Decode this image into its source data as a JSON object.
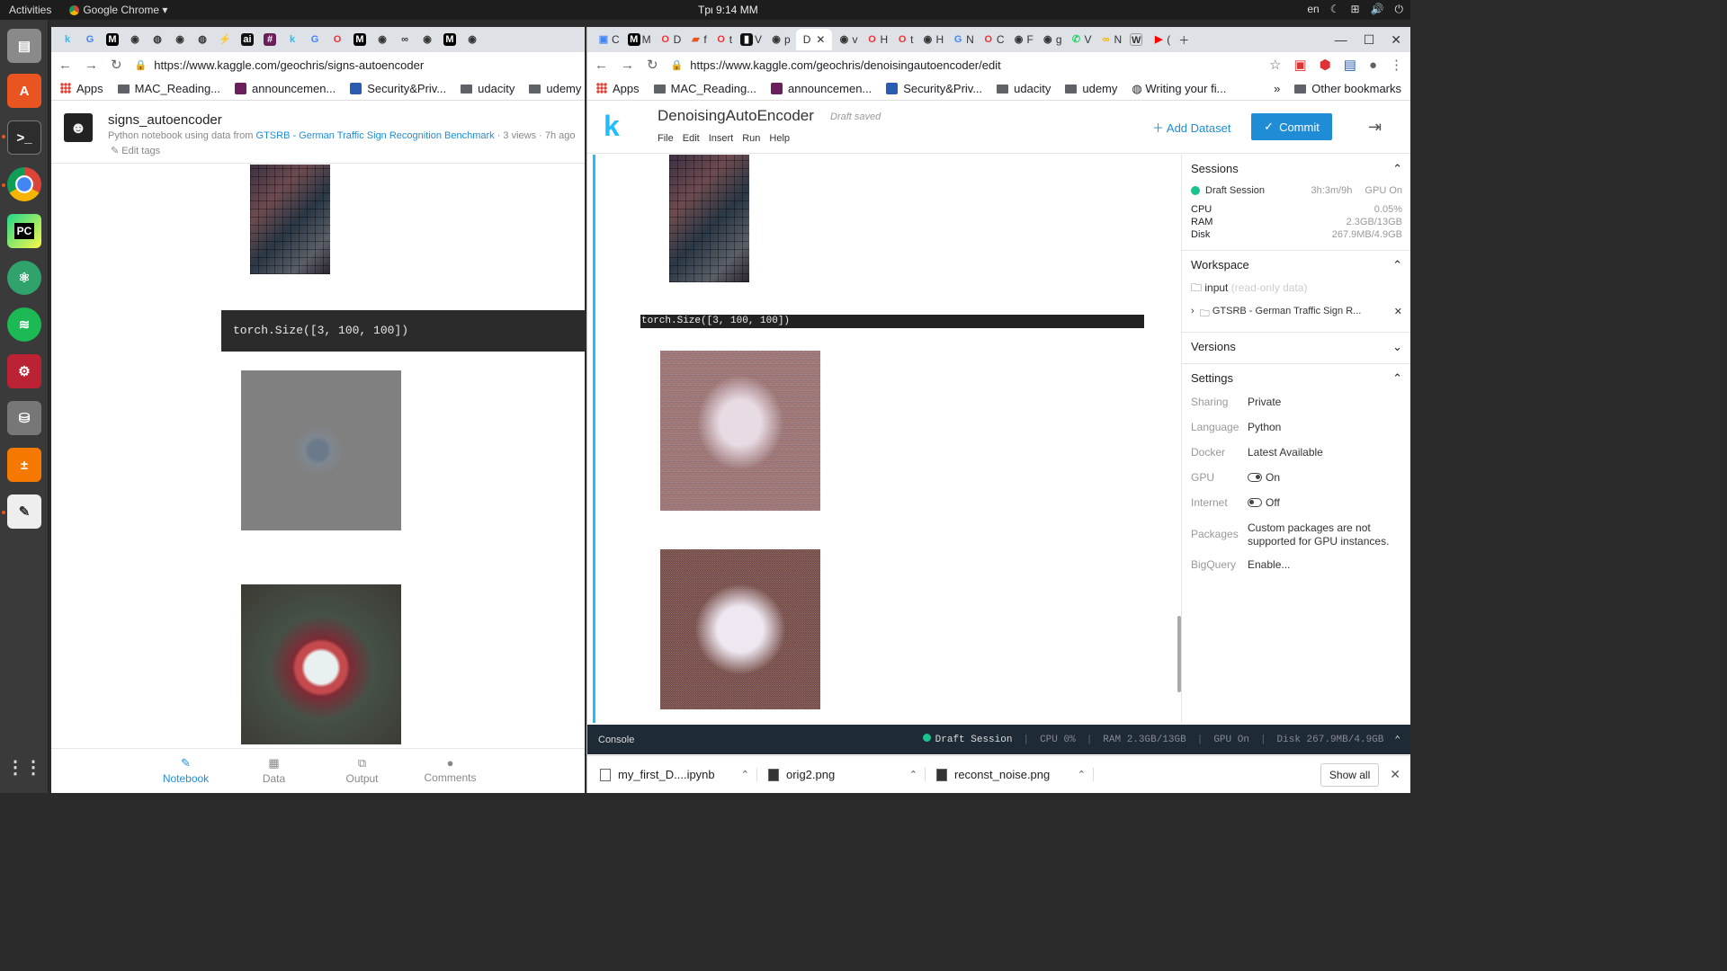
{
  "topbar": {
    "activities": "Activities",
    "app_name": "Google Chrome",
    "clock": "Tpι 9:14 MM",
    "lang": "en"
  },
  "left": {
    "tabs": [
      "k",
      "G",
      "M",
      "",
      "",
      "",
      "",
      "",
      "ai",
      "",
      "k",
      "G",
      "",
      "M",
      "",
      "",
      "",
      "M",
      ""
    ],
    "url": "https://www.kaggle.com/geochris/signs-autoencoder",
    "bookmarks": [
      "Apps",
      "MAC_Reading...",
      "announcemen...",
      "Security&Priv...",
      "udacity",
      "udemy"
    ],
    "kernel": {
      "title": "signs_autoencoder",
      "sub_prefix": "Python notebook using data from",
      "dataset_link": "GTSRB - German Traffic Sign Recognition Benchmark",
      "sub_suffix": "· 3 views · 7h ago",
      "edit_tags": "Edit tags"
    },
    "output_text": "torch.Size([3, 100, 100])",
    "bottom_tabs": [
      "Notebook",
      "Data",
      "Output",
      "Comments"
    ]
  },
  "right": {
    "tabs": [
      "C",
      "M",
      "F",
      "D",
      "f",
      "t",
      "V",
      "p",
      "D",
      "v",
      "H",
      "t",
      "H",
      "N",
      "C",
      "F",
      "g",
      "V",
      "N",
      "W",
      "("
    ],
    "active_tab": "D",
    "url": "https://www.kaggle.com/geochris/denoisingautoencoder/edit",
    "bookmarks": [
      "Apps",
      "MAC_Reading...",
      "announcemen...",
      "Security&Priv...",
      "udacity",
      "udemy",
      "Writing your fi..."
    ],
    "other_bookmarks": "Other bookmarks",
    "editor": {
      "title": "DenoisingAutoEncoder",
      "saved": "Draft saved",
      "menu": [
        "File",
        "Edit",
        "Insert",
        "Run",
        "Help"
      ],
      "add_dataset": "Add Dataset",
      "commit": "Commit"
    },
    "output_text": "torch.Size([3, 100, 100])",
    "sidebar": {
      "sessions_title": "Sessions",
      "session_name": "Draft Session",
      "session_time": "3h:3m/9h",
      "gpu_status": "GPU On",
      "cpu_label": "CPU",
      "cpu_value": "0.05%",
      "ram_label": "RAM",
      "ram_value": "2.3GB/13GB",
      "disk_label": "Disk",
      "disk_value": "267.9MB/4.9GB",
      "workspace_title": "Workspace",
      "input_label": "input",
      "input_note": "(read-only data)",
      "dataset": "GTSRB - German Traffic Sign R...",
      "versions_title": "Versions",
      "settings_title": "Settings",
      "settings": {
        "sharing_k": "Sharing",
        "sharing_v": "Private",
        "language_k": "Language",
        "language_v": "Python",
        "docker_k": "Docker",
        "docker_v": "Latest Available",
        "gpu_k": "GPU",
        "gpu_v": "On",
        "internet_k": "Internet",
        "internet_v": "Off",
        "packages_k": "Packages",
        "packages_v": "Custom packages are not supported for GPU instances.",
        "bigquery_k": "BigQuery",
        "bigquery_v": "Enable..."
      }
    },
    "console": {
      "label": "Console",
      "session": "Draft Session",
      "cpu": "CPU 0%",
      "ram": "RAM 2.3GB/13GB",
      "gpu": "GPU On",
      "disk": "Disk 267.9MB/4.9GB"
    },
    "downloads": [
      "my_first_D....ipynb",
      "orig2.png",
      "reconst_noise.png"
    ],
    "show_all": "Show all"
  }
}
